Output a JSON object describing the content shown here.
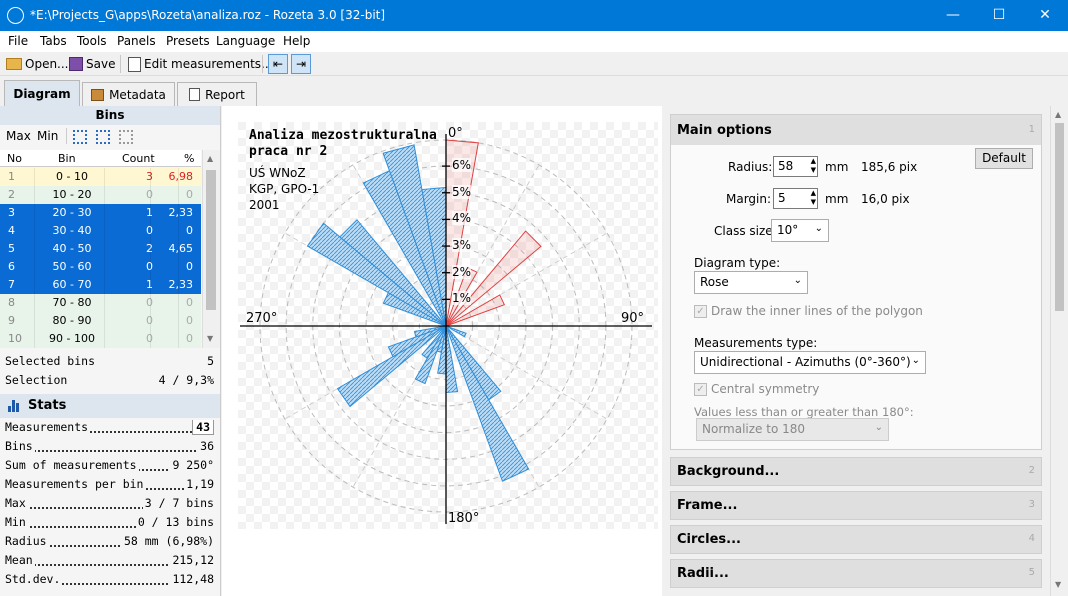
{
  "window": {
    "title": "*E:\\Projects_G\\apps\\Rozeta\\analiza.roz - Rozeta 3.0  [32-bit]"
  },
  "menu": [
    "File",
    "Tabs",
    "Tools",
    "Panels",
    "Presets",
    "Language",
    "Help"
  ],
  "toolbar": {
    "open": "Open...",
    "save": "Save",
    "edit": "Edit measurements..."
  },
  "tabs": [
    "Diagram",
    "Metadata",
    "Report"
  ],
  "bins": {
    "title": "Bins",
    "max": "Max",
    "min": "Min",
    "columns": [
      "No",
      "Bin",
      "Count",
      "%"
    ],
    "rows": [
      {
        "no": "1",
        "bin": "0 - 10",
        "count": "3",
        "pct": "6,98",
        "state": "yel"
      },
      {
        "no": "2",
        "bin": "10 - 20",
        "count": "0",
        "pct": "0",
        "state": "grn"
      },
      {
        "no": "3",
        "bin": "20 - 30",
        "count": "1",
        "pct": "2,33",
        "state": "sel"
      },
      {
        "no": "4",
        "bin": "30 - 40",
        "count": "0",
        "pct": "0",
        "state": "sel"
      },
      {
        "no": "5",
        "bin": "40 - 50",
        "count": "2",
        "pct": "4,65",
        "state": "sel"
      },
      {
        "no": "6",
        "bin": "50 - 60",
        "count": "0",
        "pct": "0",
        "state": "sel"
      },
      {
        "no": "7",
        "bin": "60 - 70",
        "count": "1",
        "pct": "2,33",
        "state": "sel"
      },
      {
        "no": "8",
        "bin": "70 - 80",
        "count": "0",
        "pct": "0",
        "state": "grn"
      },
      {
        "no": "9",
        "bin": "80 - 90",
        "count": "0",
        "pct": "0",
        "state": "grn"
      },
      {
        "no": "10",
        "bin": "90 - 100",
        "count": "0",
        "pct": "0",
        "state": "grn"
      }
    ],
    "selected_bins_label": "Selected bins",
    "selected_bins": "5",
    "selection_label": "Selection",
    "selection": "4 / 9,3%"
  },
  "stats": {
    "title": "Stats",
    "lines": [
      {
        "label": "Measurements",
        "value": "43"
      },
      {
        "label": "Bins",
        "value": "36"
      },
      {
        "label": "Sum of measurements",
        "value": "9 250°"
      },
      {
        "label": "Measurements per bin",
        "value": "1,19"
      },
      {
        "label": "Max",
        "value": "3 / 7 bins"
      },
      {
        "label": "Min",
        "value": "0 / 13 bins"
      },
      {
        "label": "Radius",
        "value": "58 mm (6,98%)"
      },
      {
        "label": "Mean",
        "value": "215,12"
      },
      {
        "label": "Std.dev.",
        "value": "112,48"
      }
    ]
  },
  "diagram": {
    "title1": "Analiza mezostrukturalna",
    "title2": "praca nr 2",
    "meta1": "UŚ WNoZ",
    "meta2": "KGP, GPO-1",
    "meta3": "2001",
    "n": "0°",
    "e": "90°",
    "s": "180°",
    "w": "270°",
    "rings": [
      "1%",
      "2%",
      "3%",
      "4%",
      "5%",
      "6%"
    ],
    "max_pct": 6.98,
    "petals": [
      {
        "start": 0,
        "end": 10,
        "pct": 6.98,
        "color": "red"
      },
      {
        "start": 20,
        "end": 30,
        "pct": 2.33,
        "color": "red"
      },
      {
        "start": 40,
        "end": 50,
        "pct": 4.65,
        "color": "red"
      },
      {
        "start": 60,
        "end": 70,
        "pct": 2.33,
        "color": "red"
      },
      {
        "start": 110,
        "end": 120,
        "pct": 0.8,
        "color": "blue"
      },
      {
        "start": 140,
        "end": 150,
        "pct": 3.2,
        "color": "blue"
      },
      {
        "start": 150,
        "end": 160,
        "pct": 6.2,
        "color": "blue"
      },
      {
        "start": 170,
        "end": 180,
        "pct": 2.5,
        "color": "blue"
      },
      {
        "start": 180,
        "end": 190,
        "pct": 1.8,
        "color": "blue"
      },
      {
        "start": 190,
        "end": 200,
        "pct": 1.0,
        "color": "blue"
      },
      {
        "start": 200,
        "end": 210,
        "pct": 2.3,
        "color": "blue"
      },
      {
        "start": 210,
        "end": 220,
        "pct": 1.4,
        "color": "blue"
      },
      {
        "start": 230,
        "end": 240,
        "pct": 4.7,
        "color": "blue"
      },
      {
        "start": 240,
        "end": 250,
        "pct": 2.3,
        "color": "blue"
      },
      {
        "start": 250,
        "end": 260,
        "pct": 1.2,
        "color": "blue"
      },
      {
        "start": 290,
        "end": 300,
        "pct": 2.5,
        "color": "blue"
      },
      {
        "start": 300,
        "end": 310,
        "pct": 6.0,
        "color": "blue"
      },
      {
        "start": 310,
        "end": 320,
        "pct": 5.2,
        "color": "blue"
      },
      {
        "start": 330,
        "end": 340,
        "pct": 6.2,
        "color": "blue"
      },
      {
        "start": 340,
        "end": 350,
        "pct": 6.9,
        "color": "blue"
      },
      {
        "start": 350,
        "end": 360,
        "pct": 5.2,
        "color": "blue"
      }
    ],
    "colors": {
      "blue": "#2f8fdb",
      "red": "#e04040"
    }
  },
  "options": {
    "main_title": "Main options",
    "main_num": "1",
    "radius_label": "Radius:",
    "radius": "58",
    "radius_unit": "mm",
    "radius_pix": "185,6 pix",
    "margin_label": "Margin:",
    "margin": "5",
    "margin_unit": "mm",
    "margin_pix": "16,0 pix",
    "default": "Default",
    "class_label": "Class size:",
    "class_size": "10°",
    "dtype_label": "Diagram type:",
    "dtype": "Rose",
    "inner_lines": "Draw the inner lines of the polygon",
    "mtype_label": "Measurements type:",
    "mtype": "Unidirectional - Azimuths (0°-360°)",
    "central": "Central symmetry",
    "values_label": "Values less than or greater than 180°:",
    "normalize": "Normalize to 180",
    "sections": [
      {
        "title": "Background...",
        "num": "2"
      },
      {
        "title": "Frame...",
        "num": "3"
      },
      {
        "title": "Circles...",
        "num": "4"
      },
      {
        "title": "Radii...",
        "num": "5"
      }
    ]
  }
}
